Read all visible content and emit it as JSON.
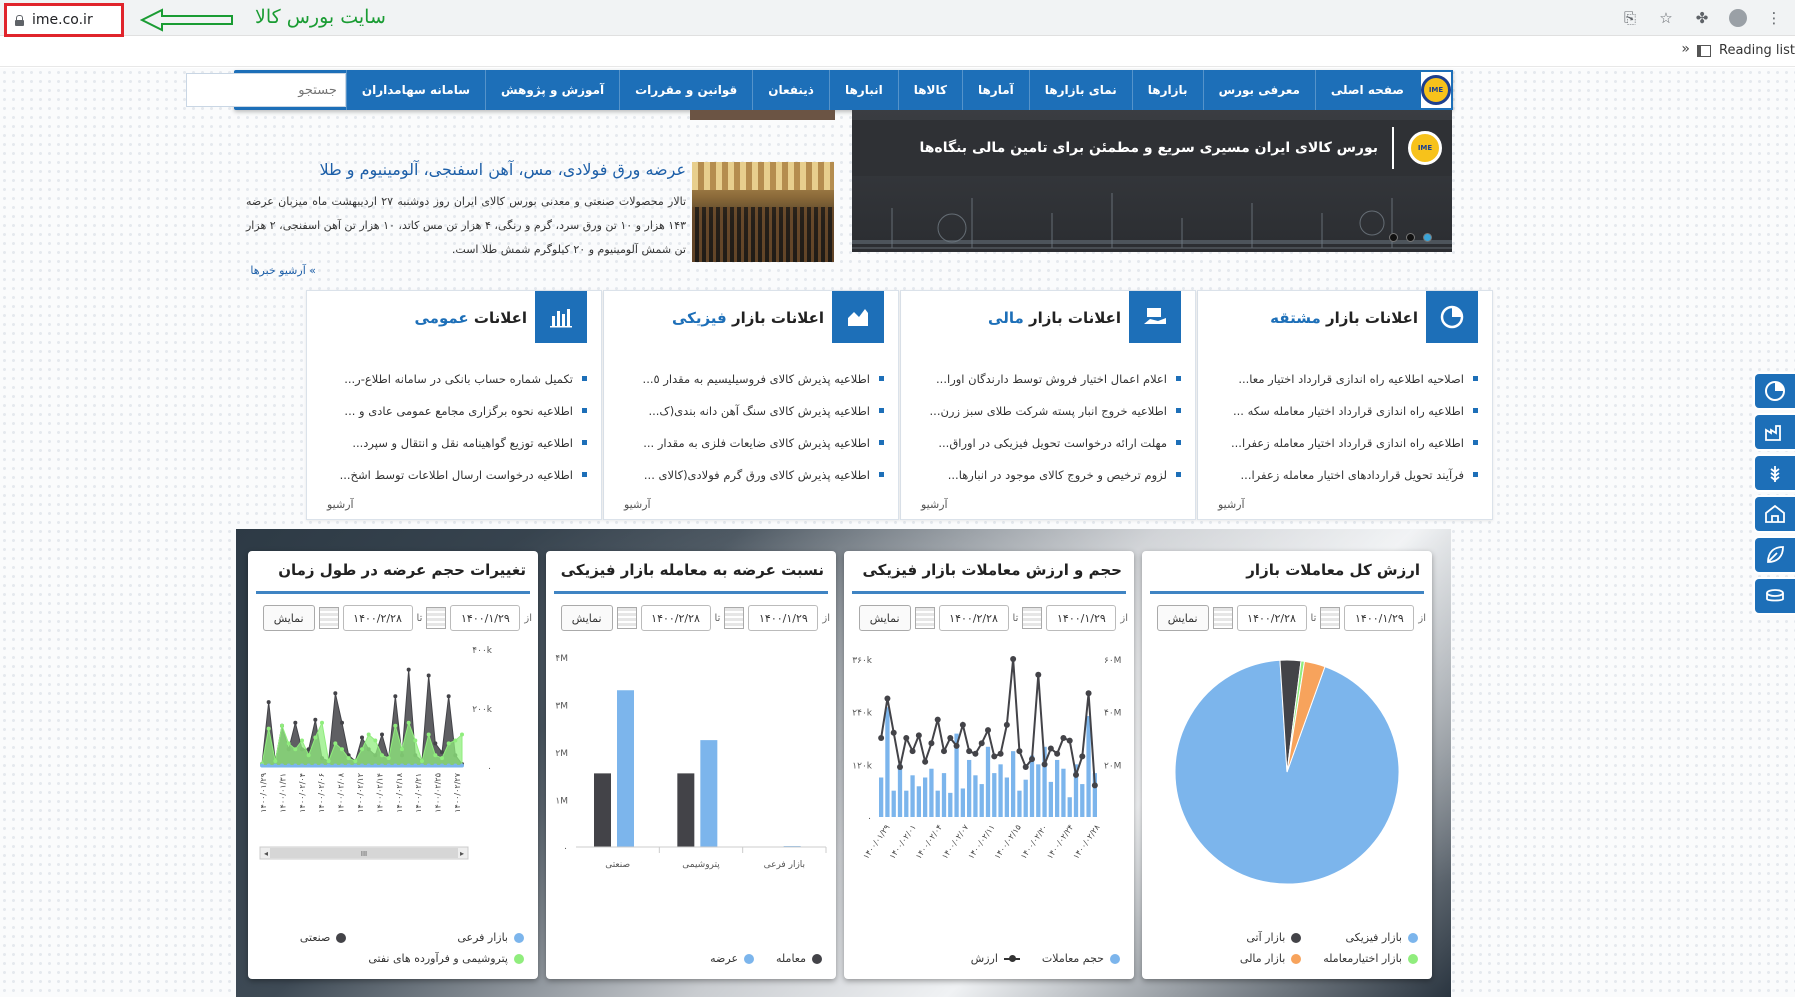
{
  "browser": {
    "url": "ime.co.ir",
    "annotation": "سایت بورس کالا",
    "reading_list": "Reading list",
    "chevron": "»"
  },
  "nav": {
    "logo": "IME",
    "items": [
      "صفحه اصلی",
      "معرفی بورس",
      "بازارها",
      "نمای بازارها",
      "آمارها",
      "کالاها",
      "انبارها",
      "ذینفعان",
      "قوانین و مقررات",
      "آموزش و پژوهش",
      "سامانه سهامداران"
    ],
    "search_placeholder": "جستجو"
  },
  "banner": {
    "title": "بورس کالای ایران مسیری سریع و مطمئن برای تامین مالی بنگاه‌ها",
    "logo": "IME"
  },
  "news": {
    "title": "عرضه ورق فولادی، مس، آهن اسفنجی، آلومینیوم و طلا",
    "body": "تالار محصولات صنعتی و معدنی بورس کالای ایران روز دوشنبه ۲۷ اردیبهشت ماه میزبان عرضه ۱۴۳ هزار و ۱۰ تن ورق سرد، گرم و رنگی، ۴ هزار تن مس کاتد، ۱۰ هزار تن آهن اسفنجی، ۲ هزار تن شمش آلومینیوم و ۲۰ کیلوگرم شمش طلا است.",
    "archive": "» آرشیو خبرها"
  },
  "cards": [
    {
      "title_prefix": "اعلانات بازار ",
      "title_hl": "مشتقه",
      "items": [
        "اصلاحیه اطلاعیه راه اندازی قرارداد اختیار معا...",
        "اطلاعیه راه اندازی قرارداد اختیار معامله سکه ...",
        "اطلاعیه راه اندازی قرارداد اختیار معامله زعفرا...",
        "فرآیند تحویل قراردادهای اختیار معامله زعفرا..."
      ],
      "archive": "آرشیو",
      "icon": "pie-chart-icon"
    },
    {
      "title_prefix": "اعلانات بازار ",
      "title_hl": "مالی",
      "items": [
        "اعلام اعمال اختیار فروش توسط دارندگان اورا...",
        "اطلاعیه خروج انبار پسته شرکت طلای سبز زرن...",
        "مهلت ارائه درخواست تحویل فیزیکی در اوراق...",
        "لزوم ترخیص و خروج کالای موجود در انبارها..."
      ],
      "archive": "آرشیو",
      "icon": "money-hand-icon"
    },
    {
      "title_prefix": "اعلانات بازار ",
      "title_hl": "فیزیکی",
      "items": [
        "اطلاعیه پذیرش کالای فروسیلیسیم به مقدار ٥...",
        "اطلاعیه پذیرش کالای سنگ آهن دانه بندی(ک...",
        "اطلاعیه پذیرش کالای ضایعات فلزی به مقدار ...",
        "اطلاعیه پذیرش کالای ورق گرم فولادی(کالای ..."
      ],
      "archive": "آرشیو",
      "icon": "area-chart-icon"
    },
    {
      "title_prefix": "اعلانات ",
      "title_hl": "عمومی",
      "items": [
        "تکمیل شماره حساب بانکی در سامانه اطلاع-ر...",
        "اطلاعیه نحوه برگزاری مجامع عمومی عادی و ...",
        "اطلاعیه توزیع گواهینامه نقل و انتقال و سپرد...",
        "اطلاعیه درخواست ارسال اطلاعات توسط اشخ..."
      ],
      "archive": "آرشیو",
      "icon": "bar-chart-icon"
    }
  ],
  "filters": {
    "from_label": "از",
    "to_label": "تا",
    "from_date": "۱۴۰۰/۱/۲۹",
    "to_date": "۱۴۰۰/۲/۲۸",
    "button": "نمایش"
  },
  "panels": {
    "p1": {
      "title": "ارزش کل معاملات بازار",
      "legend": [
        "بازار فیزیکی",
        "بازار آتی",
        "بازار اختیارمعامله",
        "بازار مالی"
      ]
    },
    "p2": {
      "title": "حجم و ارزش معاملات بازار فیزیکی",
      "legend": [
        "حجم معاملات",
        "ارزش"
      ]
    },
    "p3": {
      "title": "نسبت عرضه به معامله بازار فیزیکی",
      "legend": [
        "معامله",
        "عرضه"
      ]
    },
    "p4": {
      "title": "تغییرات حجم عرضه در طول زمان",
      "legend": [
        "بازار فرعی",
        "صنعتی",
        "پتروشیمی و فرآورده های نفتی"
      ],
      "scroll_grip": "III"
    }
  },
  "chart_data": [
    {
      "type": "pie",
      "title": "ارزش کل معاملات بازار",
      "slices": [
        {
          "name": "بازار فیزیکی",
          "value": 93.5,
          "color": "#7cb5ec"
        },
        {
          "name": "بازار آتی",
          "value": 3.0,
          "color": "#434348"
        },
        {
          "name": "بازار اختیارمعامله",
          "value": 0.5,
          "color": "#90ed7d"
        },
        {
          "name": "بازار مالی",
          "value": 3.0,
          "color": "#f7a35c"
        }
      ]
    },
    {
      "type": "bar",
      "title": "حجم و ارزش معاملات بازار فیزیکی",
      "categories": [
        "۱۴۰۰/۰۱/۲۹",
        "۱۴۰۰/۰۲/۰۱",
        "۱۴۰۰/۰۲/۰۴",
        "۱۴۰۰/۰۲/۰۷",
        "۱۴۰۰/۰۲/۱۱",
        "۱۴۰۰/۰۲/۱۵",
        "۱۴۰۰/۰۲/۲۰",
        "۱۴۰۰/۰۲/۲۴",
        "۱۴۰۰/۰۲/۲۸"
      ],
      "yticks_left": [
        "۳۶۰k",
        "۲۴۰k",
        "۱۲۰k",
        "۰"
      ],
      "yticks_right": [
        "۶۰M",
        "۴۰M",
        "۲۰M",
        ""
      ],
      "series": [
        {
          "name": "حجم معاملات",
          "values": [
            90,
            250,
            60,
            120,
            60,
            95,
            70,
            90,
            110,
            60,
            100,
            55,
            190,
            65,
            130,
            95,
            75,
            160,
            100,
            120,
            90,
            150,
            60,
            85,
            140,
            120,
            160,
            80,
            130,
            110,
            45,
            120,
            75,
            230,
            100
          ]
        },
        {
          "name": "ارزش",
          "values": [
            300,
            450,
            320,
            190,
            300,
            250,
            310,
            210,
            280,
            370,
            250,
            300,
            270,
            350,
            250,
            240,
            280,
            330,
            230,
            240,
            350,
            600,
            250,
            190,
            220,
            540,
            200,
            260,
            240,
            300,
            290,
            160,
            230,
            470,
            120
          ]
        }
      ]
    },
    {
      "type": "bar",
      "title": "نسبت عرضه به معامله بازار فیزیکی",
      "categories": [
        "بازار فرعی",
        "پتروشیمی",
        "صنعتی"
      ],
      "yticks": [
        "۴M",
        "۳M",
        "۲M",
        "۱M",
        "۰"
      ],
      "series": [
        {
          "name": "معامله",
          "values": [
            0,
            1.55,
            1.55
          ]
        },
        {
          "name": "عرضه",
          "values": [
            0.02,
            2.25,
            3.3
          ]
        }
      ]
    },
    {
      "type": "area",
      "title": "تغییرات حجم عرضه در طول زمان",
      "categories": [
        "۱۴۰۰/۰۱/۲۹",
        "۱۴۰۰/۰۱/۳۱",
        "۱۴۰۰/۰۲/۰۴",
        "۱۴۰۰/۰۲/۰۶",
        "۱۴۰۰/۰۲/۰۸",
        "۱۴۰۰/۰۲/۱۲",
        "۱۴۰۰/۰۲/۱۴",
        "۱۴۰۰/۰۲/۱۸",
        "۱۴۰۰/۰۲/۲۱",
        "۱۴۰۰/۰۲/۲۵",
        "۱۴۰۰/۰۲/۲۷"
      ],
      "yticks": [
        "۴۰۰k",
        "۲۰۰k",
        "۰"
      ],
      "series": [
        {
          "name": "صنعتی",
          "values": [
            10,
            220,
            20,
            140,
            60,
            150,
            60,
            60,
            160,
            30,
            20,
            250,
            150,
            40,
            20,
            100,
            60,
            40,
            110,
            30,
            240,
            40,
            330,
            40,
            20,
            310,
            80,
            50,
            240,
            40,
            10
          ]
        },
        {
          "name": "پتروشیمی و فرآورده های نفتی",
          "values": [
            10,
            130,
            20,
            140,
            80,
            60,
            90,
            40,
            100,
            150,
            20,
            80,
            60,
            30,
            20,
            60,
            110,
            90,
            40,
            30,
            140,
            60,
            150,
            90,
            20,
            110,
            40,
            30,
            80,
            90,
            110
          ]
        },
        {
          "name": "بازار فرعی",
          "values": [
            5,
            5,
            5,
            5,
            5,
            5,
            5,
            5,
            5,
            5,
            5,
            5,
            5,
            5,
            5,
            5,
            5,
            5,
            5,
            5,
            5,
            5,
            5,
            5,
            5,
            5,
            5,
            5,
            5,
            5,
            5
          ]
        }
      ]
    }
  ],
  "side_icons": [
    "pie-chart-icon",
    "factory-icon",
    "wheat-icon",
    "warehouse-icon",
    "leaf-icon",
    "coins-icon"
  ]
}
